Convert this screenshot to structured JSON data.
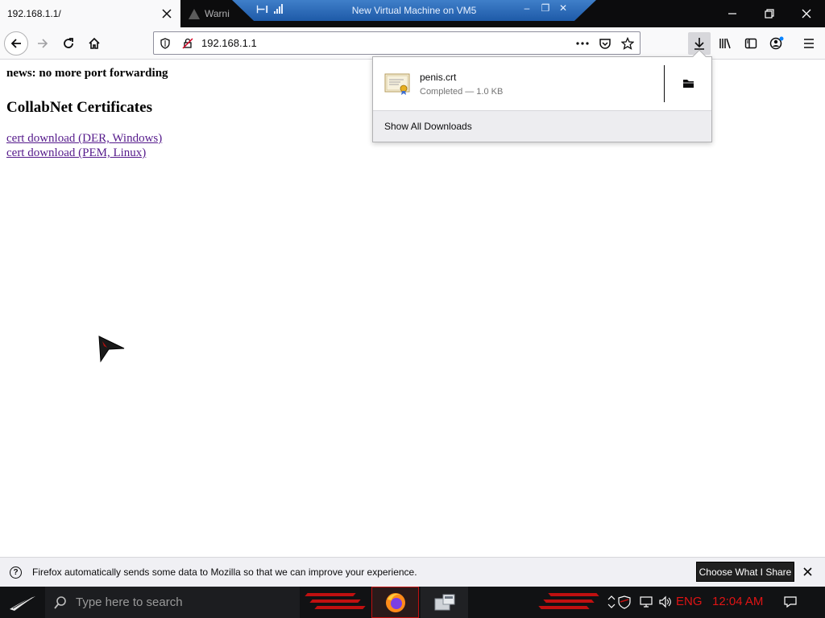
{
  "browser": {
    "active_tab": {
      "title": "192.168.1.1/"
    },
    "inactive_tab": {
      "title": "Warni"
    },
    "url": "192.168.1.1",
    "icons": {
      "back": "back-arrow-icon",
      "forward": "forward-arrow-icon",
      "reload": "reload-icon",
      "home": "home-icon",
      "tracking": "shield-icon",
      "insecure": "insecure-lock-icon",
      "page_actions": "more-icon",
      "pocket": "pocket-icon",
      "bookmark": "star-icon",
      "downloads": "download-icon",
      "library": "library-icon",
      "sidebar": "sidebar-icon",
      "account": "account-icon",
      "menu": "hamburger-menu-icon"
    }
  },
  "vm_banner": {
    "title": "New Virtual Machine on VM5"
  },
  "page": {
    "news": "news: no more port forwarding",
    "heading": "CollabNet Certificates",
    "links": [
      "cert download (DER, Windows)",
      "cert download (PEM, Linux)"
    ]
  },
  "downloads": {
    "item": {
      "filename": "penis.crt",
      "status": "Completed — 1.0 KB"
    },
    "footer": "Show All Downloads"
  },
  "notification": {
    "text": "Firefox automatically sends some data to Mozilla so that we can improve your experience.",
    "button": "Choose What I Share"
  },
  "taskbar": {
    "search_placeholder": "Type here to search",
    "language": "ENG",
    "time": "12:04 AM"
  },
  "colors": {
    "link_visited": "#551a8b",
    "taskbar_accent": "#e01414",
    "vm_banner": "#2a68b8"
  }
}
